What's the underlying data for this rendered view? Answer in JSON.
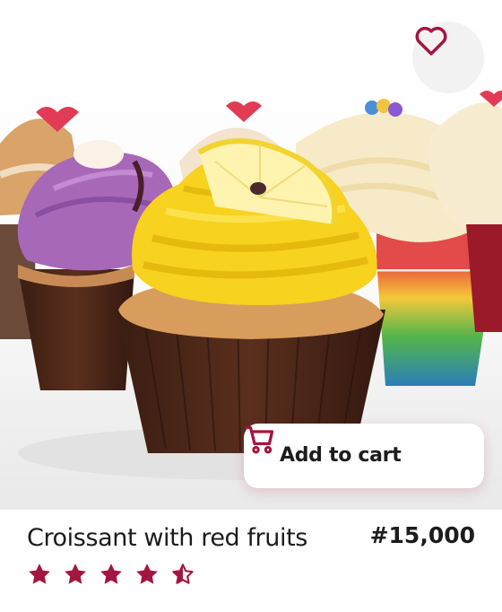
{
  "product": {
    "name": "Croissant with red fruits",
    "price": "#15,000",
    "rating": 4.5,
    "rating_max": 5,
    "image_alt": "cupcakes"
  },
  "actions": {
    "add_to_cart_label": "Add to cart"
  },
  "icons": {
    "favorite": "heart-outline-icon",
    "cart": "shopping-cart-icon",
    "star": "star-icon"
  },
  "colors": {
    "accent": "#a3163f",
    "text": "#1c1c1c",
    "fav_bg": "#f2f2f2"
  }
}
